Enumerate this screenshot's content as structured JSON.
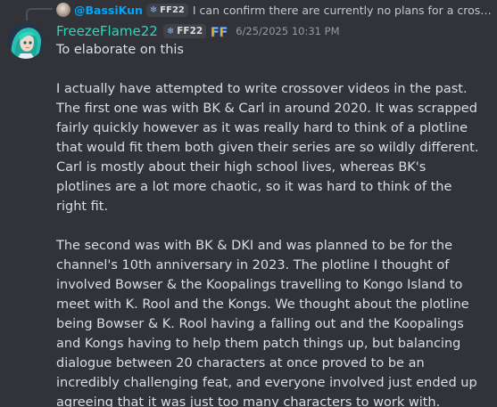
{
  "reply": {
    "username": "@BassiKun",
    "tag": "FF22",
    "text": "I can confirm there are currently no plans for a crossov..."
  },
  "message": {
    "username": "FreezeFlame22",
    "tag": "FF22",
    "badge_letters": "FF",
    "timestamp": "6/25/2025 10:31 PM",
    "paragraphs": [
      "To elaborate on this",
      "I actually have attempted to write crossover videos in the past. The first one was with BK & Carl in around 2020. It was scrapped fairly quickly however as it was really hard to think of a plotline that would fit them both given their series are so wildly different. Carl is mostly about their high school lives, whereas BK's plotlines are a lot more chaotic, so it was hard to think of the right fit.",
      "The second was with BK & DKI and was planned to be for the channel's 10th anniversary in 2023. The plotline I thought of involved Bowser & the Koopalings travelling to Kongo Island to meet with K. Rool and the Kongs. We thought about the plotline being Bowser & K. Rool having a falling out and the Koopalings and Kongs having to help them patch things up, but balancing dialogue between 20 characters at once proved to be an incredibly challenging feat, and everyone involved just ended up agreeing that it was just too many characters to work with."
    ]
  },
  "colors": {
    "background": "#313338",
    "username": "#34d3bd",
    "reply_username": "#00a8fc",
    "text": "#dbdee1",
    "timestamp": "#949ba4"
  },
  "icons": {
    "reply_avatar": "user-avatar-icon",
    "tag_emblem": "clan-emblem-icon",
    "badge": "ff-logo-icon"
  }
}
